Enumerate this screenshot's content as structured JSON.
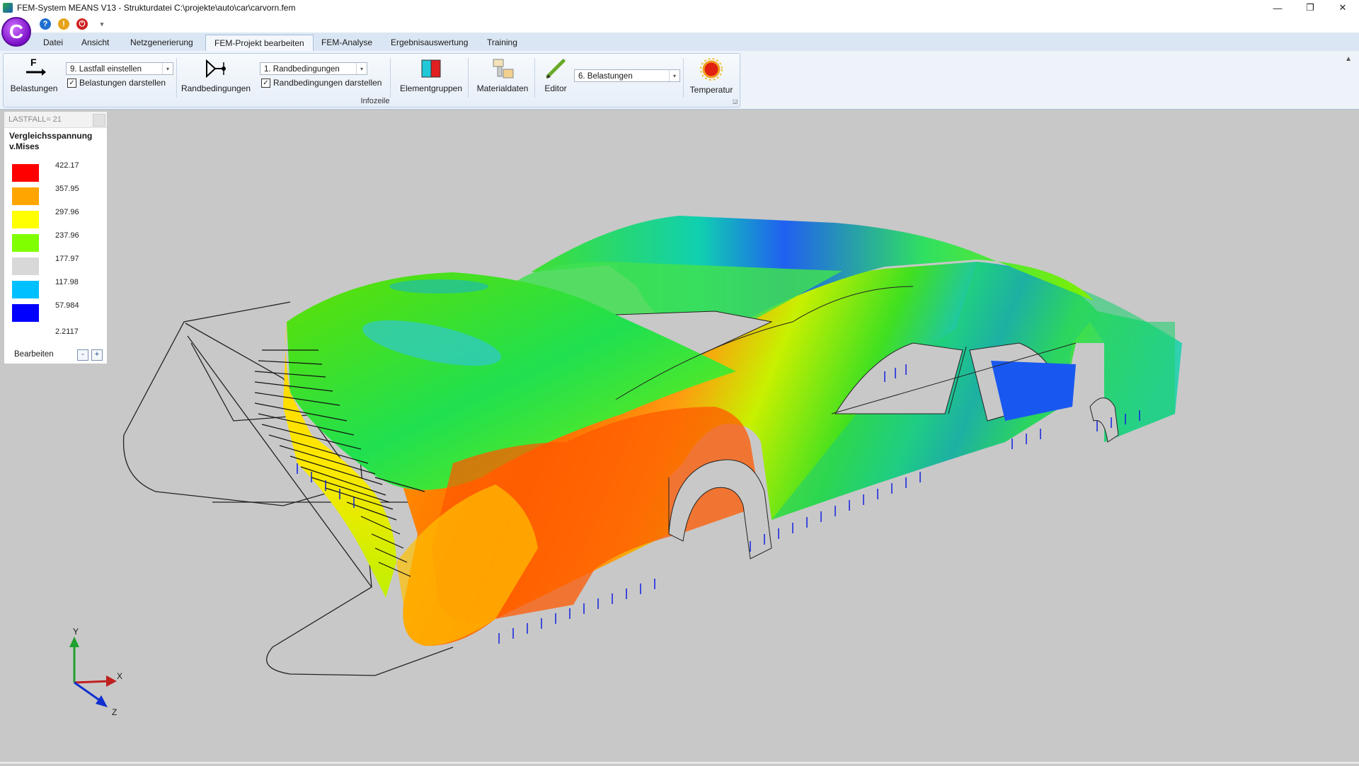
{
  "window": {
    "title": "FEM-System MEANS V13 - Strukturdatei  C:\\projekte\\auto\\car\\carvorn.fem",
    "controls": [
      "—",
      "❐",
      "✕"
    ]
  },
  "logo_letter": "C",
  "quick_access": [
    "?",
    "!",
    "⏻",
    "▾"
  ],
  "tabs": [
    "Datei",
    "Ansicht",
    "Netzgenerierung",
    "FEM-Projekt bearbeiten",
    "FEM-Analyse",
    "Ergebnisauswertung",
    "Training"
  ],
  "active_tab": "FEM-Projekt bearbeiten",
  "ribbon": {
    "belastungen_label": "Belastungen",
    "belastungen_icon_letter": "F",
    "lastfall_select": "9.   Lastfall einstellen",
    "belastungen_darstellen": "Belastungen darstellen",
    "randbedingungen_label": "Randbedingungen",
    "randbedingungen_select": "1.   Randbedingungen",
    "randbedingungen_darstellen": "Randbedingungen darstellen",
    "elementgruppen_label": "Elementgruppen",
    "materialdaten_label": "Materialdaten",
    "editor_label": "Editor",
    "editor_select": "6.   Belastungen",
    "temperatur_label": "Temperatur",
    "group_label": "Infozeile"
  },
  "legend": {
    "lastfall": "LASTFALL=  21",
    "title_line1": "Vergleichsspannung",
    "title_line2": "v.Mises",
    "entries": [
      {
        "value": "422.17",
        "color": "#ff0000"
      },
      {
        "value": "357.95",
        "color": "#ffa500"
      },
      {
        "value": "297.96",
        "color": "#ffff00"
      },
      {
        "value": "237.96",
        "color": "#80ff00"
      },
      {
        "value": "177.97",
        "color": "#d8d8d8"
      },
      {
        "value": "117.98",
        "color": "#00c0ff"
      },
      {
        "value": "57.984",
        "color": "#0000ff"
      },
      {
        "value": "2.2117",
        "color": ""
      }
    ],
    "edit_label": "Bearbeiten",
    "minus": "-",
    "plus": "+"
  },
  "axes": {
    "x": "X",
    "y": "Y",
    "z": "Z"
  },
  "colors": {
    "ribbon_bg": "#eef3fa",
    "viewport_bg": "#c8c8c8",
    "tab_bar": "#dbe6f4"
  }
}
